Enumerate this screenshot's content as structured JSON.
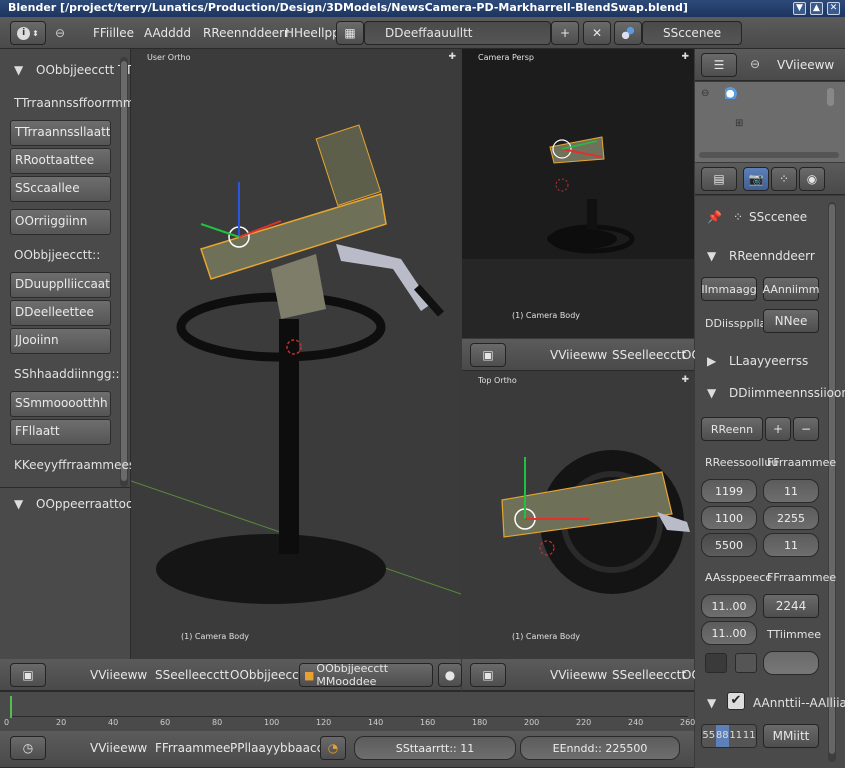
{
  "window": {
    "title": "Blender [/project/terry/Lunatics/Production/Design/3DModels/NewsCamera-PD-Markharrell-BlendSwap.blend]",
    "controls": [
      "▼",
      "▲",
      "✕"
    ]
  },
  "top_header": {
    "menus": [
      "FFiillee",
      "AAdddd",
      "RReennddeerr",
      "HHeellpp"
    ],
    "layout_name": "DDeeffaauulltt",
    "scene_name": "SSccenee"
  },
  "toolshelf": {
    "panel_title": "OObbjjeecctt TToo",
    "transform_label": "TTrraannssffoorrmm::",
    "transform_buttons": [
      "TTrraannssllaattee",
      "RRoottaattee",
      "SSccaallee"
    ],
    "origin_button": "OOrriiggiinn",
    "object_label": "OObbjjeecctt::",
    "object_buttons": [
      "DDuupplliiccaattee OO",
      "DDeelleettee",
      "JJooiinn"
    ],
    "shading_label": "SShhaaddiinngg::",
    "shading_buttons": [
      "SSmmooootthh",
      "FFllaatt"
    ],
    "keyframes_label": "KKeeyyffrraammeess::",
    "operator_title": "OOppeerraattoorr"
  },
  "viewports": {
    "main": {
      "label": "User Ortho",
      "object": "(1) Camera Body"
    },
    "camera": {
      "label": "Camera Persp",
      "object": "(1) Camera Body"
    },
    "top": {
      "label": "Top Ortho",
      "object": "(1) Camera Body"
    }
  },
  "viewport_headers": {
    "main": {
      "menus": [
        "VViieeww",
        "SSeelleecctt",
        "OObbjjeecctt"
      ],
      "mode": "OObbjjeecctt MMooddee"
    },
    "camera": {
      "menus": [
        "VViieeww",
        "SSeelleecctt",
        "OO"
      ]
    },
    "top": {
      "menus": [
        "VViieeww",
        "SSeelleecctt",
        "OObbjjeecctt"
      ]
    }
  },
  "timeline": {
    "ticks": [
      "0",
      "20",
      "40",
      "60",
      "80",
      "100",
      "120",
      "140",
      "160",
      "180",
      "200",
      "220",
      "240",
      "260"
    ],
    "menus": [
      "VViieeww",
      "FFrraammee",
      "PPllaayybbaacckk"
    ],
    "start": "SSttaarrtt:: 11",
    "end": "EEnndd:: 225500"
  },
  "outliner": {
    "view_label": "VViieeww"
  },
  "properties": {
    "scene_label": "SSccenee",
    "render_panel": "RReennddeerr",
    "image_btn": "IImmaagg",
    "anim_btn": "AAnniimm",
    "display_label": "DDiissppllaa",
    "display_value": "NNee",
    "layers_panel": "LLaayyeerrss",
    "dimensions_panel": "DDiimmeennssiioonnss",
    "preset_value": "RReenn",
    "resolution_label": "RReessoolluu",
    "frame_range_label": "FFrraammee",
    "res_x": "1199",
    "res_y": "1100",
    "res_pct": "5500",
    "frame_start": "11",
    "frame_end": "2255",
    "frame_step": "11",
    "aspect_label": "AAssppeecc",
    "frame_rate_label": "FFrraammee",
    "aspect_x": "11..00",
    "aspect_y": "11..00",
    "fps": "2244",
    "time_label": "TTiimmee",
    "antialias_panel": "AAnnttii--AAlliiaa",
    "aa_samples": [
      "55",
      "88",
      "11",
      "11"
    ],
    "aa_filter": "MMiitt"
  }
}
